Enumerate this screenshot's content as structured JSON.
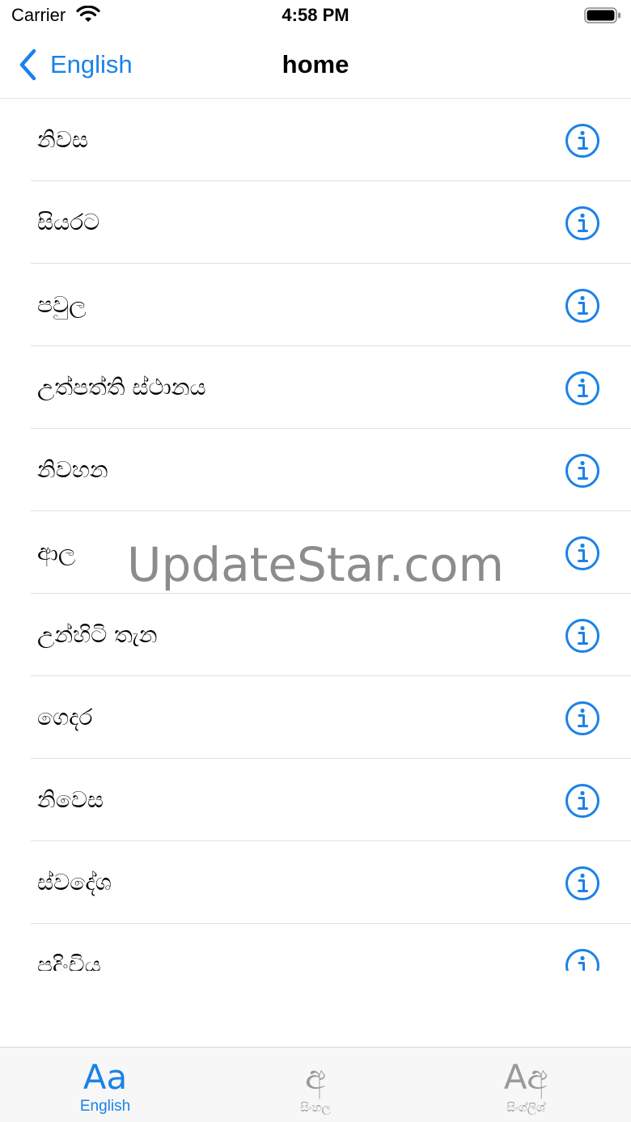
{
  "status_bar": {
    "carrier": "Carrier",
    "time": "4:58 PM"
  },
  "nav": {
    "back_label": "English",
    "title": "home"
  },
  "words": [
    {
      "label": "නිවස"
    },
    {
      "label": "සියරට"
    },
    {
      "label": "පවුල"
    },
    {
      "label": "උත්පත්ති ස්ථානය"
    },
    {
      "label": "නිවහන"
    },
    {
      "label": "ආල"
    },
    {
      "label": "උන්හිටි තැන"
    },
    {
      "label": "ගෙදර"
    },
    {
      "label": "නිවෙස"
    },
    {
      "label": "ස්වදේශ"
    },
    {
      "label": "පදිංචිය"
    }
  ],
  "watermark": "UpdateStar.com",
  "tabs": [
    {
      "glyph": "Aa",
      "label": "English",
      "active": true
    },
    {
      "glyph": "අ",
      "label": "සිංහල",
      "active": false
    },
    {
      "glyph": "Aඅ",
      "label": "සිංග්ලිශ්",
      "active": false
    }
  ],
  "colors": {
    "accent": "#1a82e8",
    "inactive": "#9a9a9a"
  }
}
